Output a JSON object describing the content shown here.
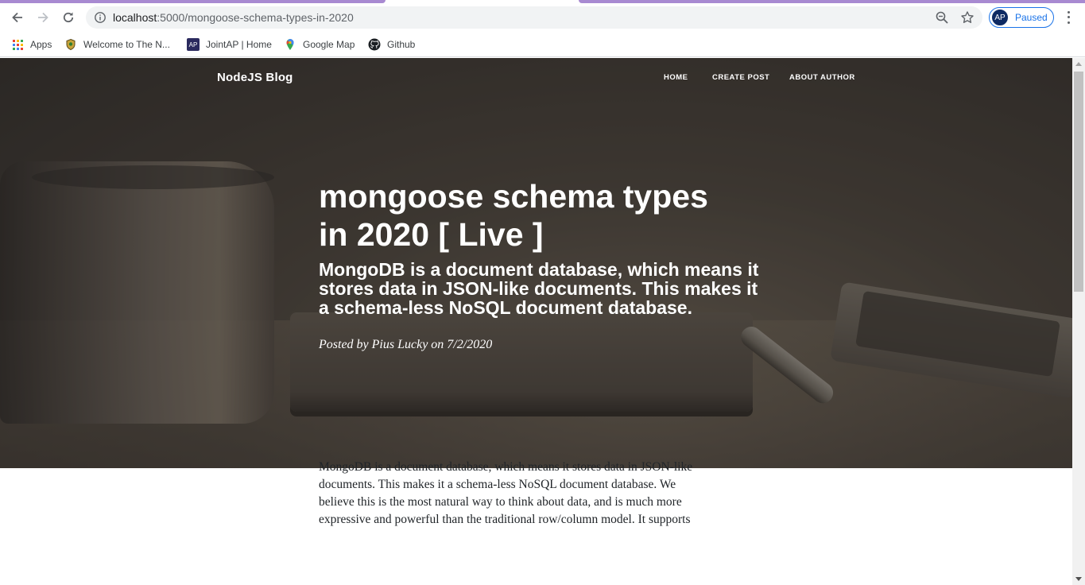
{
  "browser": {
    "url_host": "localhost",
    "url_rest": ":5000/mongoose-schema-types-in-2020",
    "profile_initials": "AP",
    "profile_status": "Paused",
    "bookmarks": [
      {
        "label": "Apps",
        "icon": "apps-grid-icon"
      },
      {
        "label": "Welcome to The N...",
        "icon": "crest-icon"
      },
      {
        "label": "JointAP | Home",
        "icon": "ap-badge-icon"
      },
      {
        "label": "Google Map",
        "icon": "map-pin-icon"
      },
      {
        "label": "Github",
        "icon": "github-icon"
      }
    ],
    "ap_badge_text": "AP"
  },
  "site": {
    "brand": "NodeJS Blog",
    "nav": [
      "HOME",
      "CREATE POST",
      "ABOUT AUTHOR"
    ]
  },
  "post": {
    "title_line1": "mongoose schema types",
    "title_line2": "in 2020 [ Live ]",
    "subtitle": "MongoDB is a document database, which means it stores data in JSON-like documents. This makes it a schema-less NoSQL document database.",
    "meta": "Posted by Pius Lucky on 7/2/2020",
    "body_lines": [
      "MongoDB is a document database, which means it stores data in JSON-like",
      "documents. This makes it a schema-less NoSQL document database. We",
      "believe this is the most natural way to think about data, and is much more",
      "expressive and powerful than the traditional row/column model. It supports"
    ]
  },
  "colors": {
    "tab_accent": "#a88ad1",
    "profile_blue": "#1a73e8"
  }
}
